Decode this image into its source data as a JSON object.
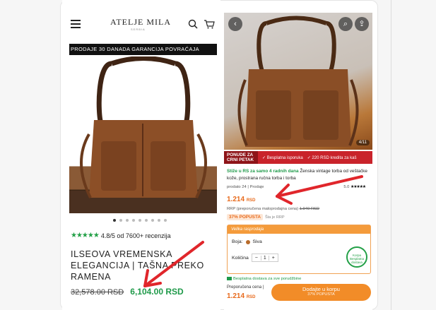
{
  "left": {
    "logo": "ATELJE MILA",
    "logo_sub": "SERBIA",
    "promo_text": "PRODAJE     30 DANADA GARANCIJA POVRAĆAJA",
    "rating_score": "4.8/5 od 7600+ recenzija",
    "stars": "★★★★★",
    "title": "ILSEOVA VREMENSKA ELEGANCIJA | TAŠNA PREKO RAMENA",
    "old_price": "32,578.00 RSD",
    "new_price": "6,104.00 RSD",
    "carousel_dots": 9,
    "carousel_active": 1
  },
  "right": {
    "counter": "4/11",
    "deal_label": "PONUDE ZA CRNI PETAK",
    "bar_item1": "✓ Besplatna isporuka",
    "bar_item2": "✓ 220 RSD kredita za kaš",
    "desc_green": "Stiže u RS za samo 4 radnih dana",
    "desc_rest": " Ženska vintage torba od veštačke kože, prostrana ručna torba i torba",
    "sold": "prodato 24 | Prodaje",
    "rating": "5.0",
    "stars": "★★★★★",
    "price": "1.214",
    "price_unit": "RSD",
    "rrp_label": "RRP (preporučena maloprodajna cena)",
    "rrp_value": "1.940 RSD",
    "discount": "37% POPUSTA",
    "discount_note": "Šta je RRP",
    "options_head": "Velika rasprodaja",
    "color_label": "Boja:",
    "color_value": "Siva",
    "qty_label": "Količina",
    "qty_minus": "−",
    "qty_value": "1",
    "qty_plus": "+",
    "badge_text": "Korpa Besplatna dostava",
    "shipping": "Besplatna dostava za sve porudžbine",
    "bottom_label": "Preporučena cena |",
    "bottom_price": "1.214",
    "bottom_unit": "RSD",
    "cta_label": "Dodajte u korpu",
    "cta_sub": "37% POPUSTA"
  },
  "colors": {
    "green": "#1f9a4a",
    "orange": "#f28c28",
    "red": "#c9232b",
    "arrow": "#e0262b"
  }
}
